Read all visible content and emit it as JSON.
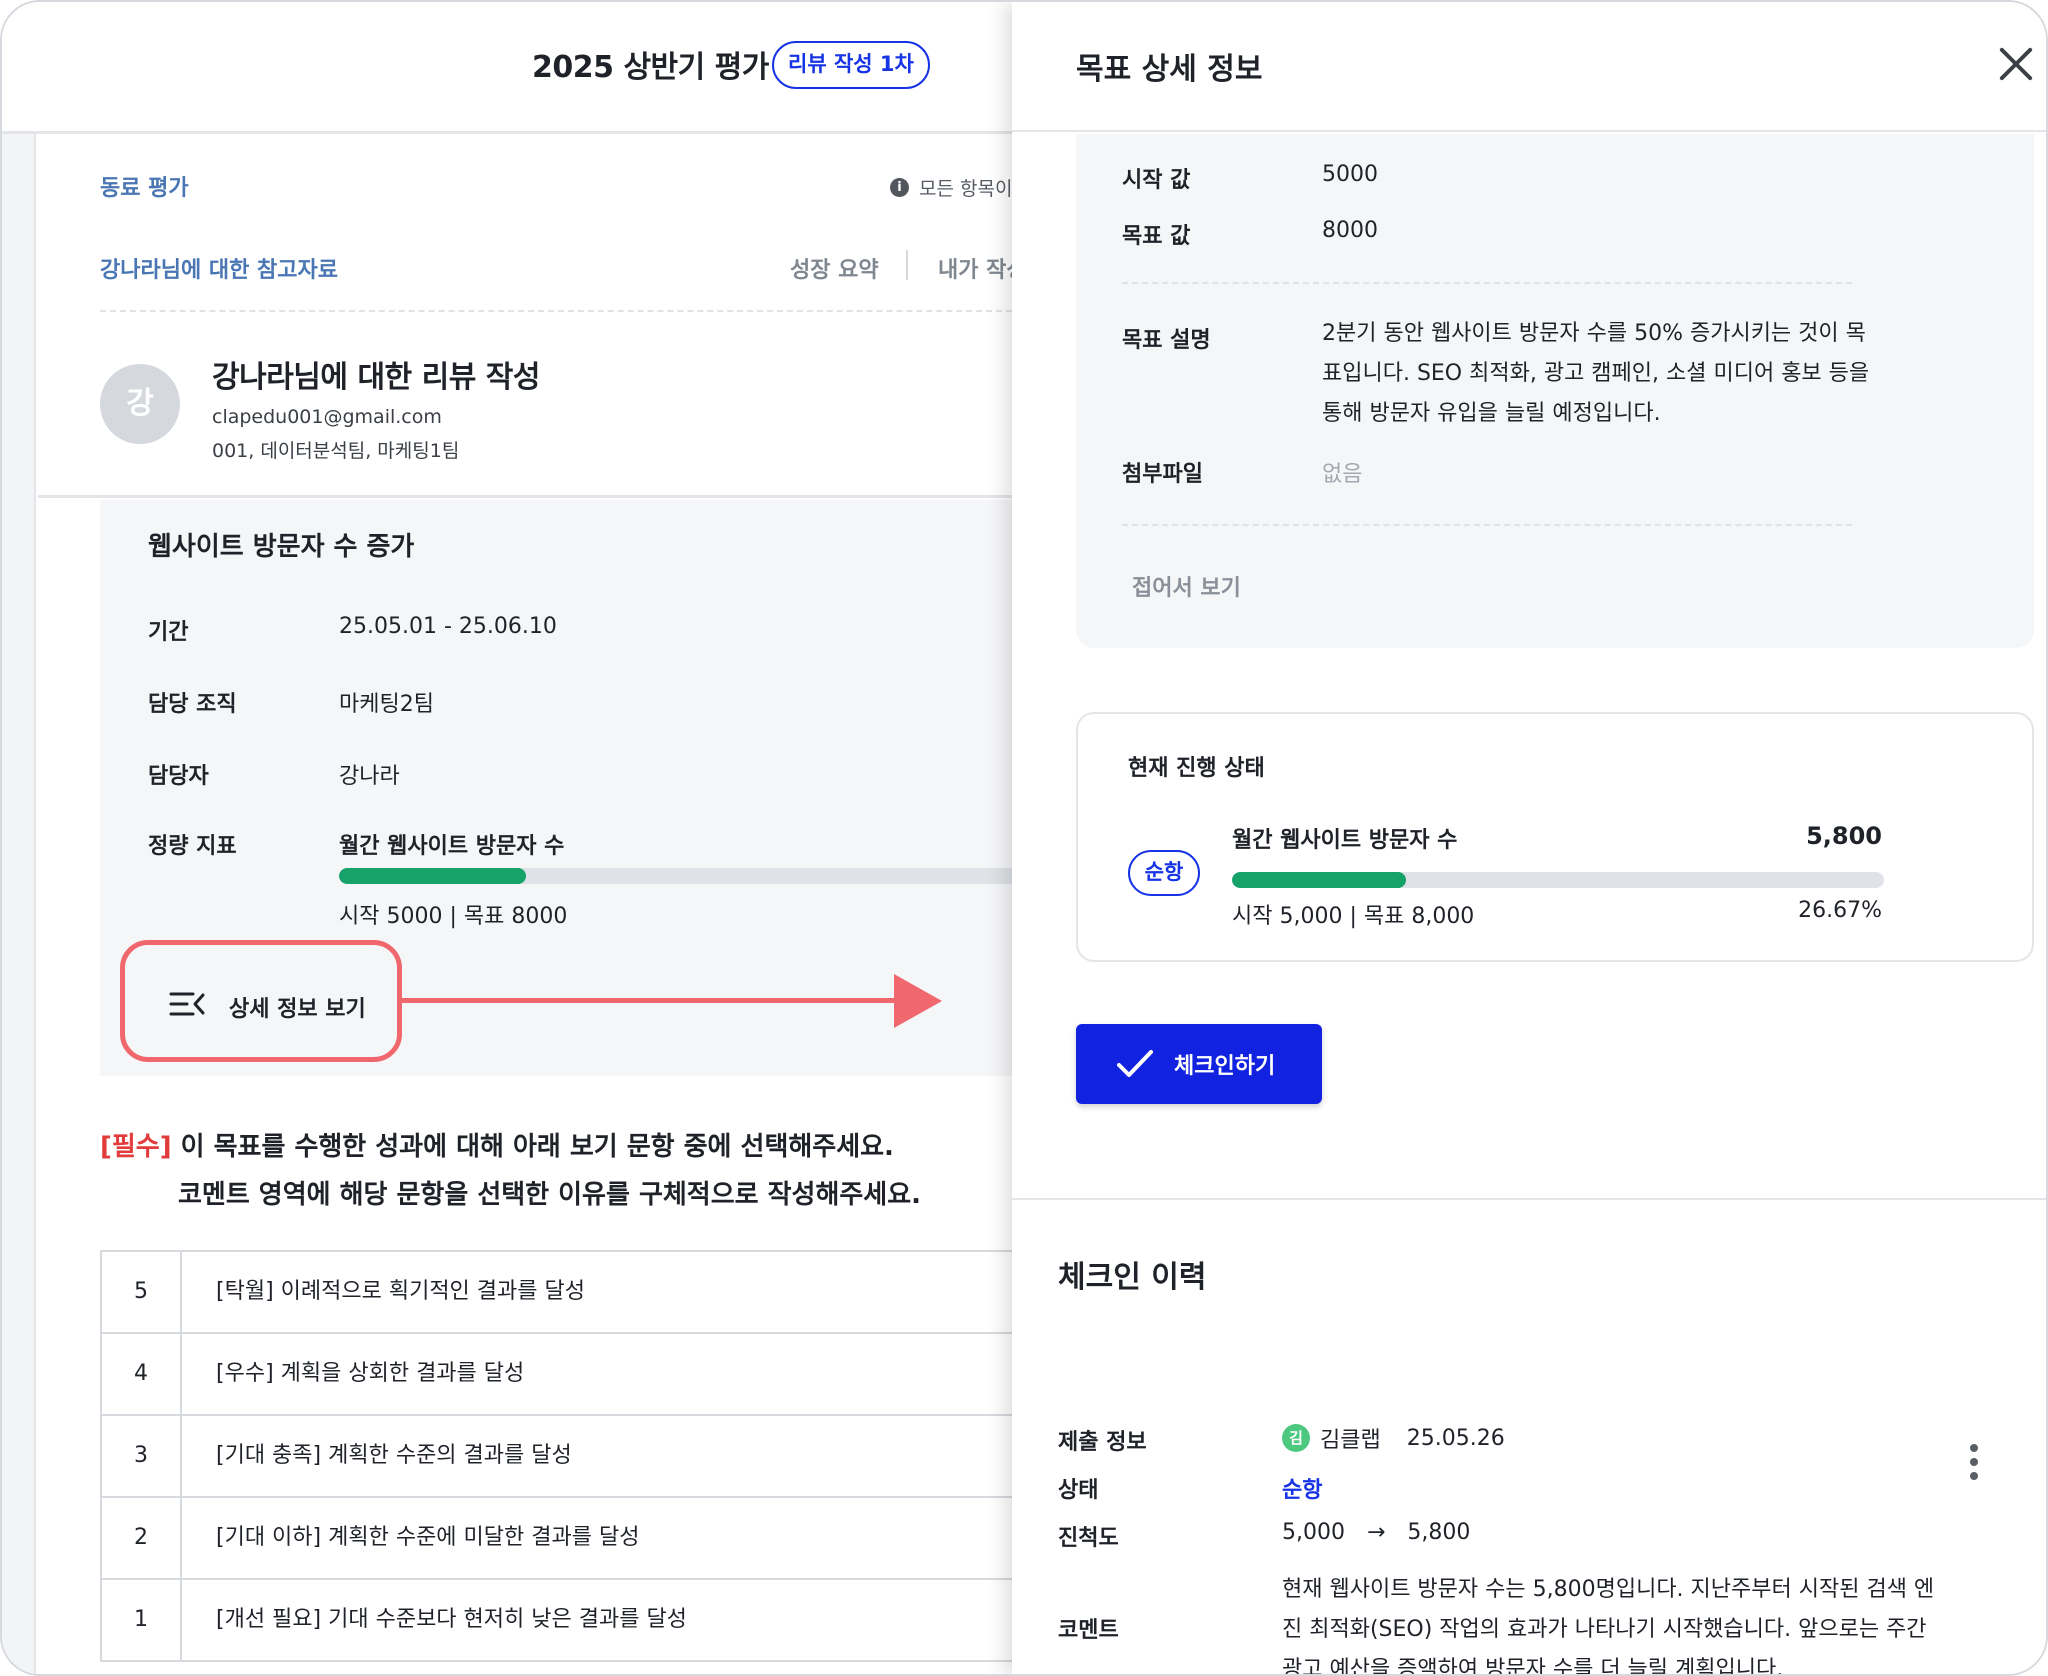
{
  "left_page": {
    "header": {
      "title": "2025 상반기 평가",
      "badge": "리뷰 작성 1차"
    },
    "breadcrumb": "동료 평가",
    "notice": "모든 항목이",
    "reference_link": "강나라님에 대한 참고자료",
    "tabs": {
      "growth_summary": "성장 요약",
      "my_written": "내가 작성"
    },
    "reviewee": {
      "avatar_initial": "강",
      "title": "강나라님에 대한 리뷰 작성",
      "email": "clapedu001@gmail.com",
      "org": "001, 데이터분석팀, 마케팅1팀"
    },
    "goal": {
      "title": "웹사이트 방문자 수 증가",
      "rows": [
        {
          "label": "기간",
          "value": "25.05.01 - 25.06.10"
        },
        {
          "label": "담당 조직",
          "value": "마케팅2팀"
        },
        {
          "label": "담당자",
          "value": "강나라"
        }
      ],
      "metric_label": "정량 지표",
      "metric_name": "월간 웹사이트 방문자 수",
      "metric_range": "시작 5000 | 목표 8000",
      "metric_progress_fraction": 0.2667,
      "detail_button": "상세 정보 보기"
    },
    "instruction": {
      "required": "[필수]",
      "line1": " 이 목표를 수행한 성과에 대해 아래 보기 문항 중에 선택해주세요.",
      "line2": "코멘트 영역에 해당 문항을 선택한 이유를 구체적으로 작성해주세요."
    },
    "scale": [
      {
        "num": "5",
        "desc": "[탁월] 이례적으로 획기적인 결과를 달성"
      },
      {
        "num": "4",
        "desc": "[우수] 계획을 상회한 결과를 달성"
      },
      {
        "num": "3",
        "desc": "[기대 충족] 계획한 수준의 결과를 달성"
      },
      {
        "num": "2",
        "desc": "[기대 이하] 계획한 수준에 미달한 결과를 달성"
      },
      {
        "num": "1",
        "desc": "[개선 필요] 기대 수준보다 현저히 낮은 결과를 달성"
      }
    ]
  },
  "drawer": {
    "title": "목표 상세 정보",
    "info": {
      "start_label": "시작 값",
      "start_value": "5000",
      "target_label": "목표 값",
      "target_value": "8000",
      "desc_label": "목표 설명",
      "desc_value": "2분기 동안 웹사이트 방문자 수를 50% 증가시키는 것이 목표입니다. SEO 최적화, 광고 캠페인, 소셜 미디어 홍보 등을 통해 방문자 유입을 늘릴 예정입니다.",
      "attach_label": "첨부파일",
      "attach_value": "없음",
      "collapse": "접어서 보기"
    },
    "status": {
      "title": "현재 진행 상태",
      "badge": "순항",
      "metric_name": "월간 웹사이트 방문자 수",
      "current": "5,800",
      "range": "시작 5,000 | 목표 8,000",
      "percent": "26.67%",
      "progress_fraction": 0.2667
    },
    "checkin_button": "체크인하기",
    "history": {
      "title": "체크인 이력",
      "submit_label": "제출 정보",
      "submitter_initial": "김",
      "submitter": "김클랩",
      "date": "25.05.26",
      "status_label": "상태",
      "status_value": "순항",
      "progress_label": "진척도",
      "progress_from": "5,000",
      "progress_arrow": "→",
      "progress_to": "5,800",
      "comment_label": "코멘트",
      "comment": "현재 웹사이트 방문자 수는 5,800명입니다. 지난주부터 시작된 검색 엔진 최적화(SEO) 작업의 효과가 나타나기 시작했습니다. 앞으로는 주간 광고 예산을 증액하여 방문자 수를 더 늘릴 계획입니다."
    }
  },
  "colors": {
    "accent_blue": "#1633e6",
    "progress_green": "#17a26a",
    "required_red": "#e23b3b",
    "highlight_red": "#f0686e"
  }
}
